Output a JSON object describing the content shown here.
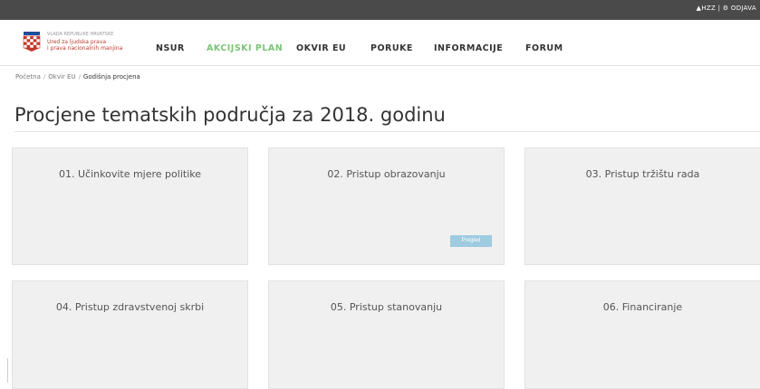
{
  "topbar": {
    "links": "▲HZZ | ⚙ ODJAVA"
  },
  "logo": {
    "line1": "VLADA REPUBLIKE HRVATSKE",
    "line2": "Ured za ljudska prava",
    "line3": "i prava nacionalnih manjina"
  },
  "nav": {
    "items": [
      {
        "label": "NSUR"
      },
      {
        "label": "AKCIJSKI PLAN",
        "active": true
      },
      {
        "label": "OKVIR EU"
      },
      {
        "label": "PORUKE"
      },
      {
        "label": "INFORMACIJE"
      },
      {
        "label": "FORUM"
      }
    ]
  },
  "breadcrumb": {
    "items": [
      "Početna",
      "Okvir EU",
      "Godišnja procjena"
    ]
  },
  "page": {
    "title": "Procjene tematskih područja za 2018. godinu"
  },
  "cards": [
    {
      "title": "01. Učinkovite mjere politike"
    },
    {
      "title": "02. Pristup obrazovanju",
      "badge": "Pregled"
    },
    {
      "title": "03. Pristup tržištu rada"
    },
    {
      "title": "04. Pristup zdravstvenoj skrbi"
    },
    {
      "title": "05. Pristup stanovanju"
    },
    {
      "title": "06. Financiranje"
    }
  ],
  "colors": {
    "topbar": "#4a4a4a",
    "nav_active": "#7cc576",
    "card_bg": "#f0f0f0",
    "badge": "#9ecbe0"
  }
}
